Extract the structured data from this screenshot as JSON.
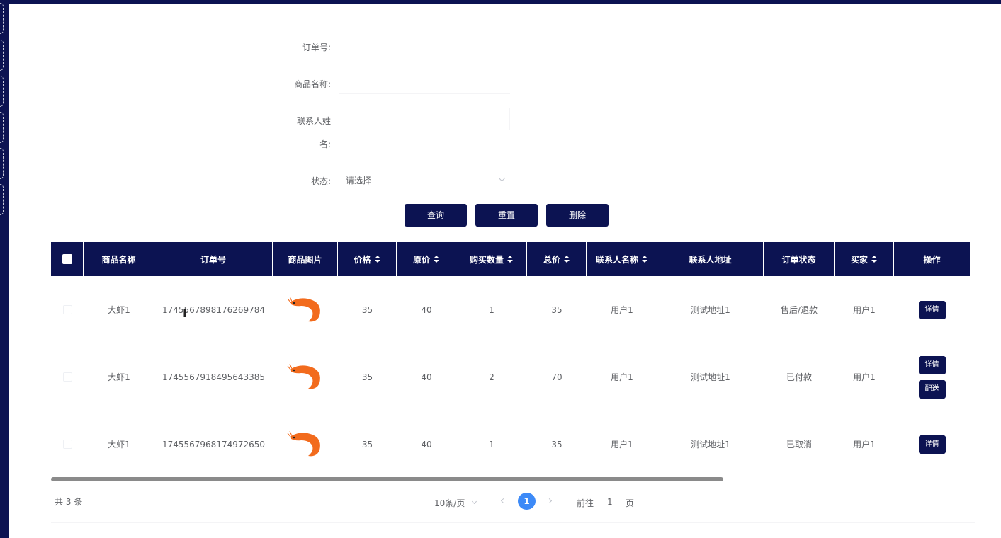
{
  "form": {
    "order_no_label": "订单号:",
    "product_name_label": "商品名称:",
    "contact_name_label_1": "联系人姓",
    "contact_name_label_2": "名:",
    "status_label": "状态:",
    "status_placeholder": "请选择"
  },
  "buttons": {
    "search": "查询",
    "reset": "重置",
    "delete": "删除"
  },
  "table": {
    "headers": [
      "商品名称",
      "订单号",
      "商品图片",
      "价格",
      "原价",
      "购买数量",
      "总价",
      "联系人名称",
      "联系人地址",
      "订单状态",
      "买家",
      "操作"
    ],
    "rows": [
      {
        "name": "大虾1",
        "order_no": "1745567898176269784",
        "price": "35",
        "orig_price": "40",
        "qty": "1",
        "total": "35",
        "contact": "用户1",
        "address": "测试地址1",
        "status": "售后/退款",
        "buyer": "用户1",
        "actions": [
          "详情"
        ]
      },
      {
        "name": "大虾1",
        "order_no": "1745567918495643385",
        "price": "35",
        "orig_price": "40",
        "qty": "2",
        "total": "70",
        "contact": "用户1",
        "address": "测试地址1",
        "status": "已付款",
        "buyer": "用户1",
        "actions": [
          "详情",
          "配送"
        ]
      },
      {
        "name": "大虾1",
        "order_no": "1745567968174972650",
        "price": "35",
        "orig_price": "40",
        "qty": "1",
        "total": "35",
        "contact": "用户1",
        "address": "测试地址1",
        "status": "已取消",
        "buyer": "用户1",
        "actions": [
          "详情"
        ]
      }
    ]
  },
  "pagination": {
    "total": "共 3 条",
    "page_size": "10条/页",
    "current_page": "1",
    "goto_label": "前往",
    "goto_value": "1",
    "page_suffix": "页"
  },
  "colors": {
    "primary": "#0c1352",
    "active_page": "#3d8af7",
    "shrimp": "#f26b1d"
  }
}
